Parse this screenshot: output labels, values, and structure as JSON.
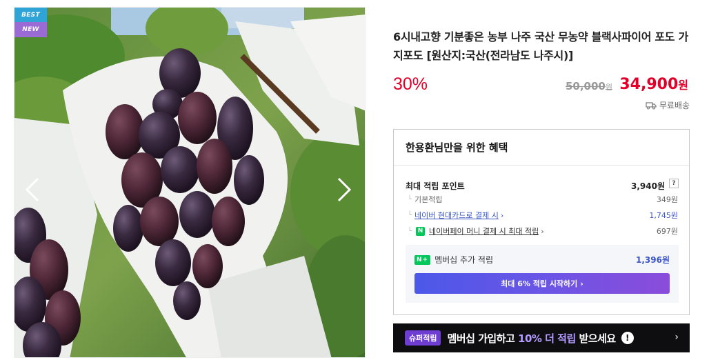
{
  "gallery": {
    "badges": [
      "BEST",
      "NEW"
    ],
    "prev_icon": "chevron-left-icon",
    "next_icon": "chevron-right-icon"
  },
  "product": {
    "title": "6시내고향 기분좋은 농부 나주 국산 무농약 블랙사파이어 포도 가지포도 [원산지:국산(전라남도 나주시)]",
    "discount": "30%",
    "original_price": "50,000",
    "original_unit": "원",
    "sale_price": "34,900",
    "sale_unit": "원",
    "shipping": "무료배송"
  },
  "benefit": {
    "heading": "한용환님만을 위한 혜택",
    "max_point_label": "최대 적립 포인트",
    "max_point_value": "3,940원",
    "help": "?",
    "rows": [
      {
        "label": "기본적립",
        "value": "349원"
      },
      {
        "label": "네이버 현대카드로 결제 시",
        "value": "1,745원"
      },
      {
        "label": "네이버페이 머니 결제 시 최대 적립",
        "value": "697원"
      }
    ],
    "npay_badge": "N",
    "member": {
      "badge": "N+",
      "label": "멤버십 추가 적립",
      "value": "1,396원",
      "button": "최대 6% 적립 시작하기"
    }
  },
  "banner": {
    "tag": "슈퍼적립",
    "text_a": "멤버십 가입하고 ",
    "text_hl": "10% 더 적립",
    "text_b": " 받으세요",
    "excl": "!"
  },
  "colors": {
    "price_red": "#e0002a",
    "naver_green": "#03c75a",
    "link_blue": "#3a55c8",
    "banner_bg": "#0e0e10"
  }
}
